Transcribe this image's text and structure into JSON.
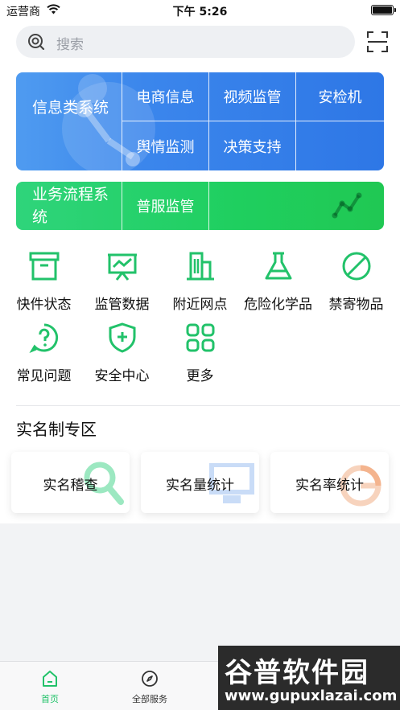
{
  "status_bar": {
    "carrier": "运营商",
    "time": "下午 5:26"
  },
  "search": {
    "placeholder": "搜索"
  },
  "info_system": {
    "title": "信息类系统",
    "items": [
      "电商信息",
      "视频监管",
      "安检机",
      "舆情监测",
      "决策支持"
    ]
  },
  "business_system": {
    "title": "业务流程系统",
    "items": [
      "普服监管"
    ]
  },
  "functions": [
    {
      "label": "快件状态",
      "icon": "archive-box-icon"
    },
    {
      "label": "监管数据",
      "icon": "chart-board-icon"
    },
    {
      "label": "附近网点",
      "icon": "building-icon"
    },
    {
      "label": "危险化学品",
      "icon": "flask-icon"
    },
    {
      "label": "禁寄物品",
      "icon": "prohibited-icon"
    },
    {
      "label": "常见问题",
      "icon": "question-icon"
    },
    {
      "label": "安全中心",
      "icon": "shield-plus-icon"
    },
    {
      "label": "更多",
      "icon": "grid-more-icon"
    }
  ],
  "real_name": {
    "title": "实名制专区",
    "cards": [
      "实名稽查",
      "实名量统计",
      "实名率统计"
    ]
  },
  "tab_bar": {
    "tabs": [
      "首页",
      "全部服务"
    ]
  },
  "watermark": {
    "line1": "谷普软件园",
    "line2": "www.gupuxlazai.com"
  },
  "colors": {
    "accent": "#22c26a",
    "blue": "#3b86ec",
    "green": "#20c853"
  }
}
